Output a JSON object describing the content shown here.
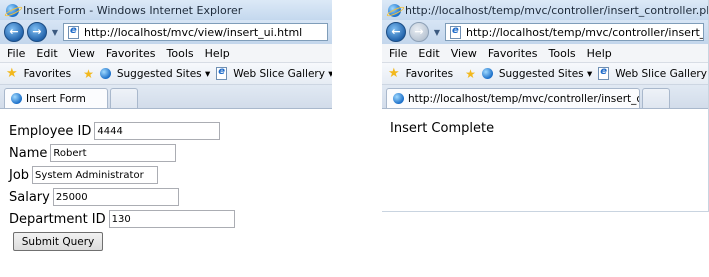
{
  "left_window": {
    "title": "Insert Form - Windows Internet Explorer",
    "url": "http://localhost/mvc/view/insert_ui.html",
    "menu": [
      "File",
      "Edit",
      "View",
      "Favorites",
      "Tools",
      "Help"
    ],
    "favorites_label": "Favorites",
    "suggested_sites": "Suggested Sites ▾",
    "web_slice_gallery": "Web Slice Gallery ▾",
    "tab_title": "Insert Form",
    "form": {
      "employee_id_label": "Employee ID",
      "employee_id_value": "4444",
      "name_label": "Name",
      "name_value": "Robert",
      "job_label": "Job",
      "job_value": "System Administrator",
      "salary_label": "Salary",
      "salary_value": "25000",
      "department_id_label": "Department ID",
      "department_id_value": "130",
      "submit_label": "Submit Query"
    }
  },
  "right_window": {
    "title": "http://localhost/temp/mvc/controller/insert_controller.php - Window",
    "url": "http://localhost/temp/mvc/controller/insert_controller.php",
    "menu": [
      "File",
      "Edit",
      "View",
      "Favorites",
      "Tools",
      "Help"
    ],
    "favorites_label": "Favorites",
    "suggested_sites": "Suggested Sites ▾",
    "web_slice_gallery": "Web Slice Gallery ▾",
    "tab_title": "http://localhost/temp/mvc/controller/insert_con...",
    "result_text": "Insert Complete"
  },
  "icons": {
    "back": "back-arrow-icon",
    "forward": "forward-arrow-icon",
    "ie": "internet-explorer-icon",
    "favorites_star": "star-icon"
  },
  "colors": {
    "chrome_blue": "#c4d8ee",
    "nav_button": "#1e5fa8",
    "favorites_star": "#f2b81d"
  }
}
